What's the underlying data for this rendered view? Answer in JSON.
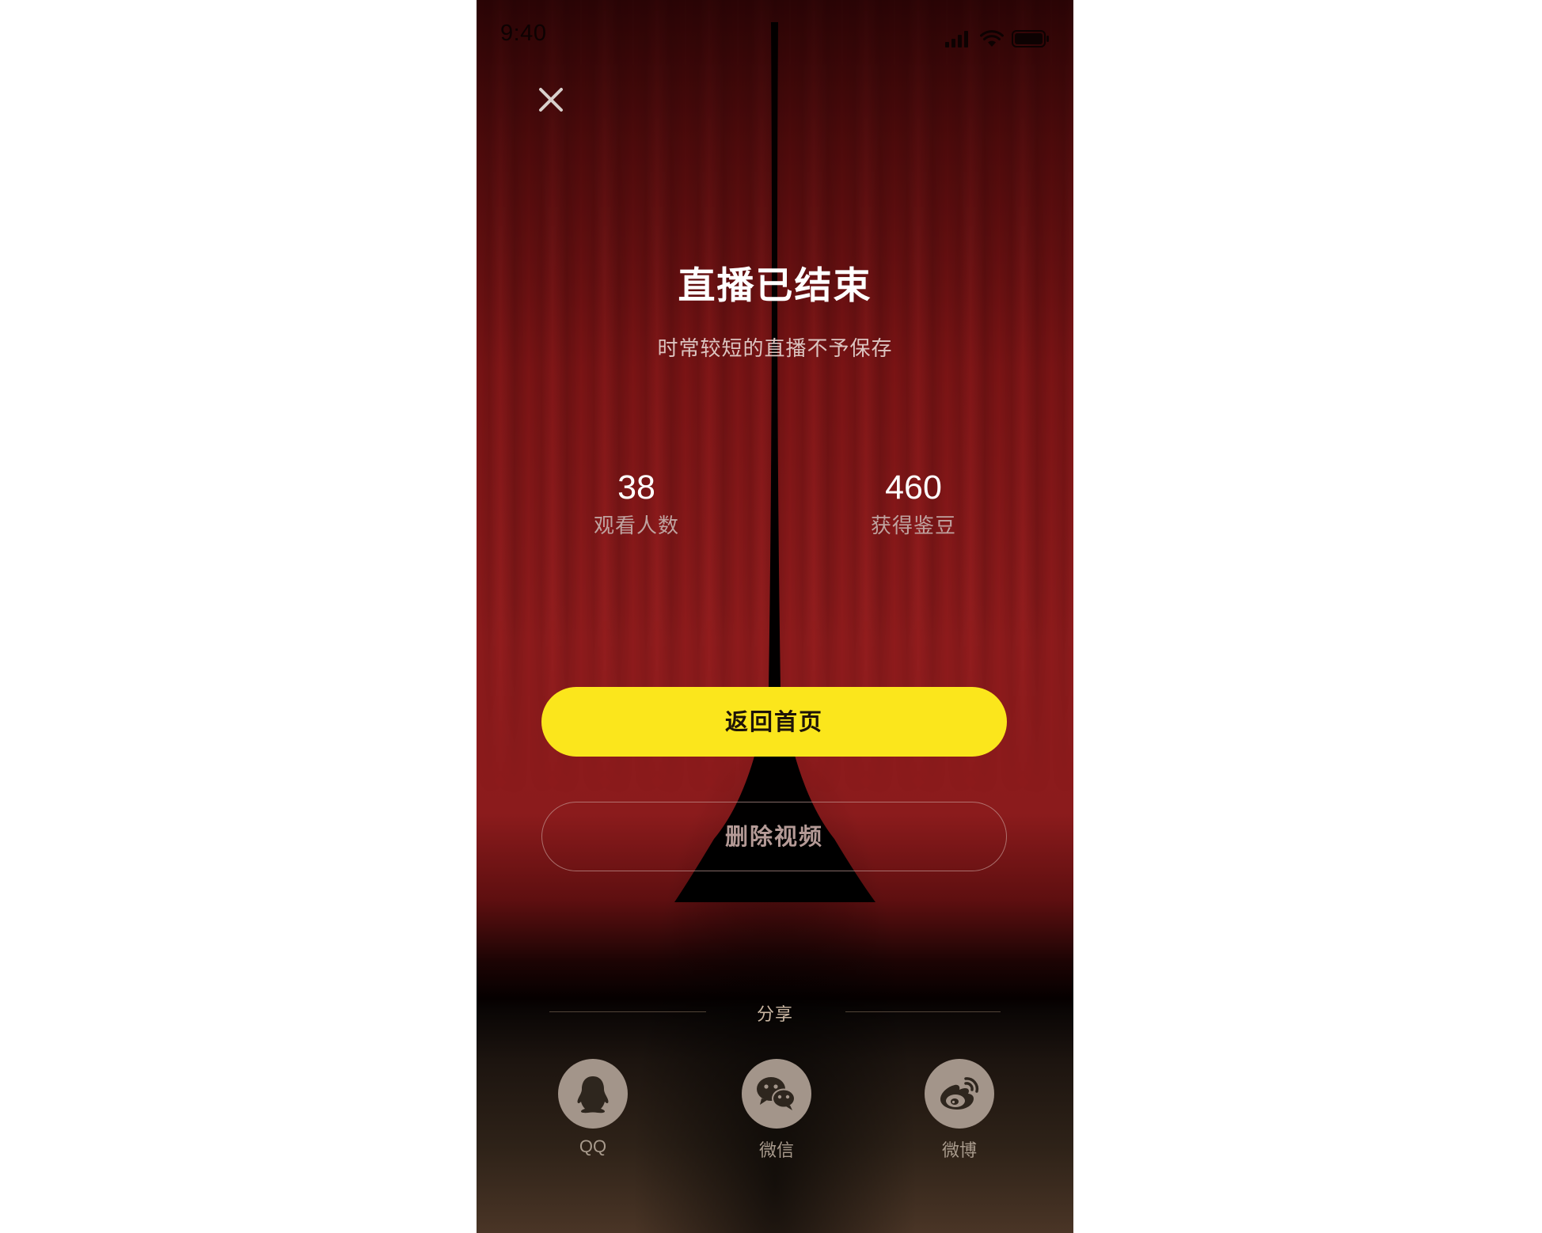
{
  "status_bar": {
    "time": "9:40",
    "icons": [
      "signal-icon",
      "wifi-icon",
      "battery-icon"
    ]
  },
  "header": {
    "close_icon": "close-icon"
  },
  "main": {
    "title": "直播已结束",
    "subtitle": "时常较短的直播不予保存",
    "stats": [
      {
        "value": "38",
        "label": "观看人数"
      },
      {
        "value": "460",
        "label": "获得鉴豆"
      }
    ],
    "primary_button": "返回首页",
    "secondary_button": "删除视频"
  },
  "share": {
    "title": "分享",
    "items": [
      {
        "label": "QQ",
        "icon": "qq-penguin-icon"
      },
      {
        "label": "微信",
        "icon": "wechat-icon"
      },
      {
        "label": "微博",
        "icon": "weibo-icon"
      }
    ]
  },
  "colors": {
    "accent_yellow": "#fbe61c",
    "curtain_red": "#8e1b1c",
    "share_icon_bg": "#a3958a",
    "share_icon_fg": "#2e261e"
  }
}
